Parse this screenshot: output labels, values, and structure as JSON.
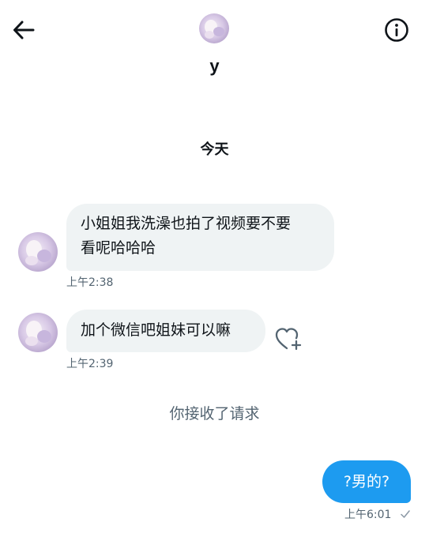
{
  "header": {
    "username": "y",
    "back_icon": "arrow-left-icon",
    "info_icon": "info-icon"
  },
  "conversation": {
    "date_separator": "今天",
    "messages": [
      {
        "direction": "incoming",
        "text_line1": "小姐姐我洗澡也拍了视频要不要",
        "text_line2": "看呢哈哈哈",
        "time": "上午2:38"
      },
      {
        "direction": "incoming",
        "text": "加个微信吧姐妹可以嘛",
        "time": "上午2:39",
        "reaction_icon": "heart-plus-icon"
      },
      {
        "direction": "outgoing",
        "text": "?男的?",
        "time": "上午6:01",
        "status_icon": "checkmark-icon"
      }
    ],
    "system_message": "你接收了请求"
  },
  "colors": {
    "incoming_bubble": "#eff3f4",
    "outgoing_bubble": "#1d9bf0",
    "muted_text": "#536471"
  }
}
